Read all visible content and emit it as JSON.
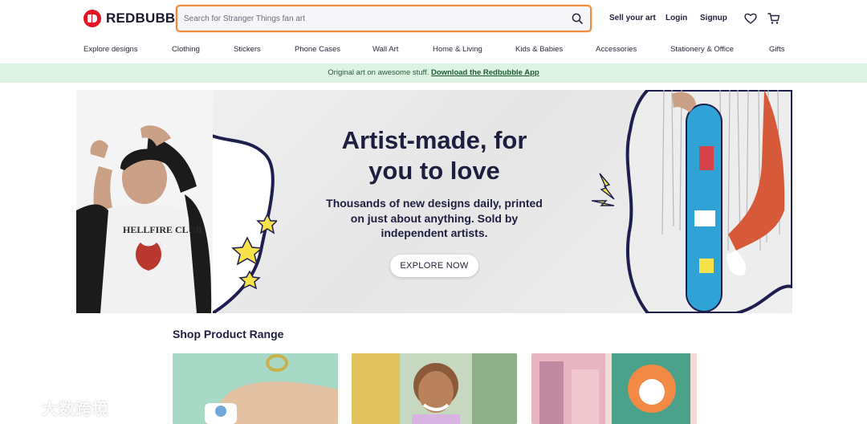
{
  "brand": {
    "name": "REDBUBBLE",
    "color": "#e41321"
  },
  "search": {
    "placeholder": "Search for Stranger Things fan art",
    "accent": "#f08a3c"
  },
  "top_links": {
    "sell": "Sell your art",
    "login": "Login",
    "signup": "Signup"
  },
  "icons": {
    "search": "search-icon",
    "wishlist": "heart-icon",
    "cart": "cart-icon"
  },
  "categories": [
    "Explore designs",
    "Clothing",
    "Stickers",
    "Phone Cases",
    "Wall Art",
    "Home & Living",
    "Kids & Babies",
    "Accessories",
    "Stationery & Office",
    "Gifts"
  ],
  "promo": {
    "text": "Original art on awesome stuff.",
    "link": "Download the Redbubble App",
    "background": "#dcf2e3"
  },
  "hero": {
    "title": "Artist-made, for you to love",
    "subtitle": "Thousands of new designs daily, printed on just about anything. Sold by independent artists.",
    "cta": "EXPLORE NOW",
    "shirt_text": "HELLFIRE CLUB"
  },
  "shop": {
    "title": "Shop Product Range"
  },
  "watermark": "大数跨境"
}
